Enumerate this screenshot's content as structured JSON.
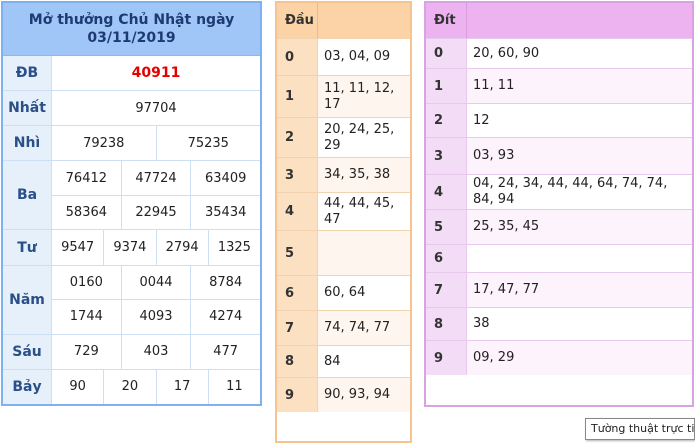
{
  "results": {
    "title_line1": "Mở thưởng Chủ Nhật ngày",
    "title_line2": "03/11/2019",
    "rows": [
      {
        "label": "ĐB",
        "lines": [
          [
            "40911"
          ]
        ],
        "special": true
      },
      {
        "label": "Nhất",
        "lines": [
          [
            "97704"
          ]
        ]
      },
      {
        "label": "Nhì",
        "lines": [
          [
            "79238",
            "75235"
          ]
        ]
      },
      {
        "label": "Ba",
        "lines": [
          [
            "76412",
            "47724",
            "63409"
          ],
          [
            "58364",
            "22945",
            "35434"
          ]
        ]
      },
      {
        "label": "Tư",
        "lines": [
          [
            "9547",
            "9374",
            "2794",
            "1325"
          ]
        ]
      },
      {
        "label": "Năm",
        "lines": [
          [
            "0160",
            "0044",
            "8784"
          ],
          [
            "1744",
            "4093",
            "4274"
          ]
        ]
      },
      {
        "label": "Sáu",
        "lines": [
          [
            "729",
            "403",
            "477"
          ]
        ]
      },
      {
        "label": "Bảy",
        "lines": [
          [
            "90",
            "20",
            "17",
            "11"
          ]
        ]
      }
    ]
  },
  "head_table": {
    "header": "Đầu",
    "rows": [
      {
        "key": "0",
        "value": "03, 04, 09"
      },
      {
        "key": "1",
        "value": "11, 11, 12, 17"
      },
      {
        "key": "2",
        "value": "20, 24, 25, 29"
      },
      {
        "key": "3",
        "value": "34, 35, 38"
      },
      {
        "key": "4",
        "value": "44, 44, 45, 47"
      },
      {
        "key": "5",
        "value": ""
      },
      {
        "key": "6",
        "value": "60, 64"
      },
      {
        "key": "7",
        "value": "74, 74, 77"
      },
      {
        "key": "8",
        "value": "84"
      },
      {
        "key": "9",
        "value": "90, 93, 94"
      }
    ]
  },
  "tail_table": {
    "header": "Đít",
    "rows": [
      {
        "key": "0",
        "value": "20, 60, 90"
      },
      {
        "key": "1",
        "value": "11, 11"
      },
      {
        "key": "2",
        "value": "12"
      },
      {
        "key": "3",
        "value": "03, 93"
      },
      {
        "key": "4",
        "value": "04, 24, 34, 44, 44, 64, 74, 74, 84, 94"
      },
      {
        "key": "5",
        "value": "25, 35, 45"
      },
      {
        "key": "6",
        "value": ""
      },
      {
        "key": "7",
        "value": "17, 47, 77"
      },
      {
        "key": "8",
        "value": "38"
      },
      {
        "key": "9",
        "value": "09, 29"
      }
    ]
  },
  "tooltip": {
    "text": "Tường thuật trực tiế"
  }
}
